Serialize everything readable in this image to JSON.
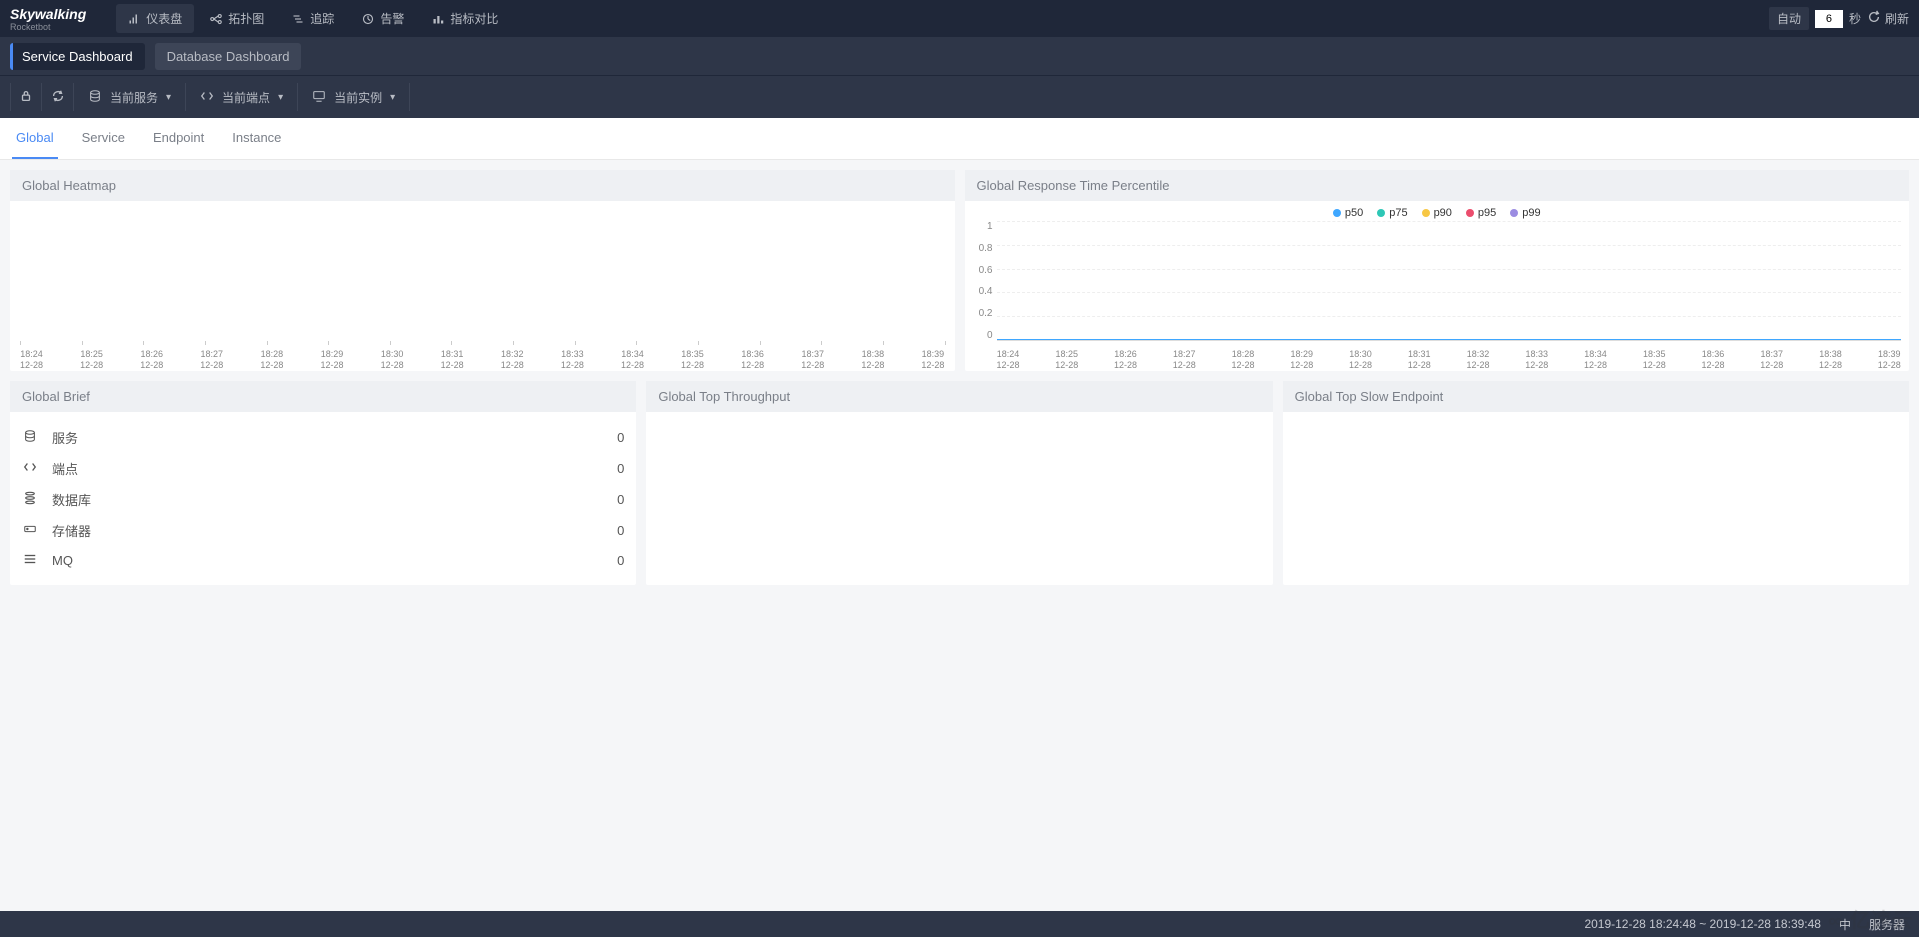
{
  "brand": {
    "name": "Skywalking",
    "sub": "Rocketbot"
  },
  "nav": {
    "items": [
      {
        "label": "仪表盘",
        "active": true
      },
      {
        "label": "拓扑图"
      },
      {
        "label": "追踪"
      },
      {
        "label": "告警"
      },
      {
        "label": "指标对比"
      }
    ]
  },
  "refresh": {
    "auto": "自动",
    "interval": "6",
    "unit": "秒",
    "btn": "刷新"
  },
  "subtabs": {
    "service": "Service Dashboard",
    "database": "Database Dashboard"
  },
  "selectors": {
    "service": "当前服务",
    "endpoint": "当前端点",
    "instance": "当前实例"
  },
  "contentTabs": {
    "global": "Global",
    "service": "Service",
    "endpoint": "Endpoint",
    "instance": "Instance"
  },
  "panels": {
    "heatmap": "Global Heatmap",
    "percentile": "Global Response Time Percentile",
    "brief": "Global Brief",
    "throughput": "Global Top Throughput",
    "slow": "Global Top Slow Endpoint"
  },
  "chart_data": {
    "type": "line",
    "title": "Global Response Time Percentile",
    "legend": [
      "p50",
      "p75",
      "p90",
      "p95",
      "p99"
    ],
    "colors": {
      "p50": "#3fa7ff",
      "p75": "#2ec7b6",
      "p90": "#f7c744",
      "p95": "#eb4d6d",
      "p99": "#9b8ce2"
    },
    "x": [
      "18:24",
      "18:25",
      "18:26",
      "18:27",
      "18:28",
      "18:29",
      "18:30",
      "18:31",
      "18:32",
      "18:33",
      "18:34",
      "18:35",
      "18:36",
      "18:37",
      "18:38",
      "18:39"
    ],
    "x_sub": "12-28",
    "ylim": [
      0,
      1
    ],
    "yticks": [
      "1",
      "0.8",
      "0.6",
      "0.4",
      "0.2",
      "0"
    ],
    "series": [
      {
        "name": "p50",
        "values": [
          0,
          0,
          0,
          0,
          0,
          0,
          0,
          0,
          0,
          0,
          0,
          0,
          0,
          0,
          0,
          0
        ]
      },
      {
        "name": "p75",
        "values": [
          0,
          0,
          0,
          0,
          0,
          0,
          0,
          0,
          0,
          0,
          0,
          0,
          0,
          0,
          0,
          0
        ]
      },
      {
        "name": "p90",
        "values": [
          0,
          0,
          0,
          0,
          0,
          0,
          0,
          0,
          0,
          0,
          0,
          0,
          0,
          0,
          0,
          0
        ]
      },
      {
        "name": "p95",
        "values": [
          0,
          0,
          0,
          0,
          0,
          0,
          0,
          0,
          0,
          0,
          0,
          0,
          0,
          0,
          0,
          0
        ]
      },
      {
        "name": "p99",
        "values": [
          0,
          0,
          0,
          0,
          0,
          0,
          0,
          0,
          0,
          0,
          0,
          0,
          0,
          0,
          0,
          0
        ]
      }
    ]
  },
  "heatmap_axis": {
    "x": [
      "18:24",
      "18:25",
      "18:26",
      "18:27",
      "18:28",
      "18:29",
      "18:30",
      "18:31",
      "18:32",
      "18:33",
      "18:34",
      "18:35",
      "18:36",
      "18:37",
      "18:38",
      "18:39"
    ],
    "x_sub": "12-28"
  },
  "brief": {
    "items": [
      {
        "icon": "database-icon",
        "label": "服务",
        "value": "0"
      },
      {
        "icon": "code-icon",
        "label": "端点",
        "value": "0"
      },
      {
        "icon": "stack-icon",
        "label": "数据库",
        "value": "0"
      },
      {
        "icon": "storage-icon",
        "label": "存储器",
        "value": "0"
      },
      {
        "icon": "list-icon",
        "label": "MQ",
        "value": "0"
      }
    ]
  },
  "footer": {
    "timerange": "2019-12-28 18:24:48 ~ 2019-12-28 18:39:48",
    "lang": "中",
    "server": "服务器"
  },
  "watermark": "亿速云"
}
